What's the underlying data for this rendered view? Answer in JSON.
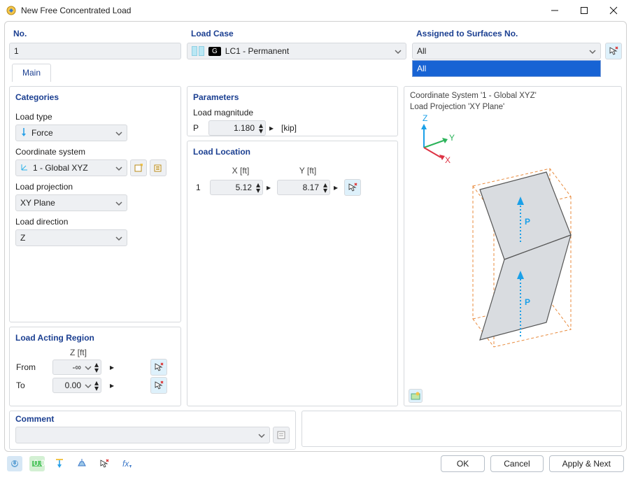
{
  "window": {
    "title": "New Free Concentrated Load"
  },
  "header": {
    "no_label": "No.",
    "no_value": "1",
    "load_case_label": "Load Case",
    "load_case_badge": "G",
    "load_case_value": "LC1 - Permanent",
    "assigned_label": "Assigned to Surfaces No.",
    "assigned_value": "All",
    "assigned_options": [
      "All"
    ]
  },
  "tabs": {
    "main": "Main"
  },
  "categories": {
    "title": "Categories",
    "load_type_label": "Load type",
    "load_type_value": "Force",
    "coord_label": "Coordinate system",
    "coord_value": "1 - Global XYZ",
    "proj_label": "Load projection",
    "proj_value": "XY Plane",
    "dir_label": "Load direction",
    "dir_value": "Z"
  },
  "region": {
    "title": "Load Acting Region",
    "col_z": "Z [ft]",
    "from_label": "From",
    "from_value": "-∞",
    "to_label": "To",
    "to_value": "0.00"
  },
  "parameters": {
    "title": "Parameters",
    "magnitude_label": "Load magnitude",
    "p_sym": "P",
    "p_value": "1.180",
    "p_unit": "[kip]"
  },
  "location": {
    "title": "Load Location",
    "x_head": "X [ft]",
    "y_head": "Y [ft]",
    "row_no": "1",
    "x_value": "5.12",
    "y_value": "8.17"
  },
  "comment": {
    "title": "Comment"
  },
  "viewer": {
    "line1": "Coordinate System '1 - Global XYZ'",
    "line2": "Load Projection 'XY Plane'",
    "p_label": "P",
    "ax_x": "X",
    "ax_y": "Y",
    "ax_z": "Z"
  },
  "footer": {
    "ok": "OK",
    "cancel": "Cancel",
    "apply": "Apply & Next"
  }
}
